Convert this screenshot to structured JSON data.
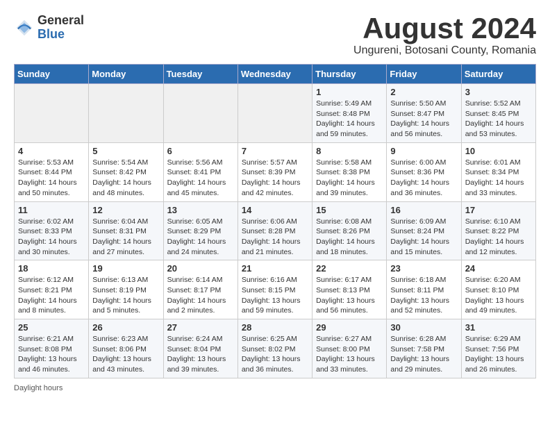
{
  "logo": {
    "general": "General",
    "blue": "Blue"
  },
  "title": {
    "month_year": "August 2024",
    "location": "Ungureni, Botosani County, Romania"
  },
  "headers": [
    "Sunday",
    "Monday",
    "Tuesday",
    "Wednesday",
    "Thursday",
    "Friday",
    "Saturday"
  ],
  "footer": {
    "note": "Daylight hours"
  },
  "weeks": [
    [
      {
        "day": "",
        "info": ""
      },
      {
        "day": "",
        "info": ""
      },
      {
        "day": "",
        "info": ""
      },
      {
        "day": "",
        "info": ""
      },
      {
        "day": "1",
        "info": "Sunrise: 5:49 AM\nSunset: 8:48 PM\nDaylight: 14 hours\nand 59 minutes."
      },
      {
        "day": "2",
        "info": "Sunrise: 5:50 AM\nSunset: 8:47 PM\nDaylight: 14 hours\nand 56 minutes."
      },
      {
        "day": "3",
        "info": "Sunrise: 5:52 AM\nSunset: 8:45 PM\nDaylight: 14 hours\nand 53 minutes."
      }
    ],
    [
      {
        "day": "4",
        "info": "Sunrise: 5:53 AM\nSunset: 8:44 PM\nDaylight: 14 hours\nand 50 minutes."
      },
      {
        "day": "5",
        "info": "Sunrise: 5:54 AM\nSunset: 8:42 PM\nDaylight: 14 hours\nand 48 minutes."
      },
      {
        "day": "6",
        "info": "Sunrise: 5:56 AM\nSunset: 8:41 PM\nDaylight: 14 hours\nand 45 minutes."
      },
      {
        "day": "7",
        "info": "Sunrise: 5:57 AM\nSunset: 8:39 PM\nDaylight: 14 hours\nand 42 minutes."
      },
      {
        "day": "8",
        "info": "Sunrise: 5:58 AM\nSunset: 8:38 PM\nDaylight: 14 hours\nand 39 minutes."
      },
      {
        "day": "9",
        "info": "Sunrise: 6:00 AM\nSunset: 8:36 PM\nDaylight: 14 hours\nand 36 minutes."
      },
      {
        "day": "10",
        "info": "Sunrise: 6:01 AM\nSunset: 8:34 PM\nDaylight: 14 hours\nand 33 minutes."
      }
    ],
    [
      {
        "day": "11",
        "info": "Sunrise: 6:02 AM\nSunset: 8:33 PM\nDaylight: 14 hours\nand 30 minutes."
      },
      {
        "day": "12",
        "info": "Sunrise: 6:04 AM\nSunset: 8:31 PM\nDaylight: 14 hours\nand 27 minutes."
      },
      {
        "day": "13",
        "info": "Sunrise: 6:05 AM\nSunset: 8:29 PM\nDaylight: 14 hours\nand 24 minutes."
      },
      {
        "day": "14",
        "info": "Sunrise: 6:06 AM\nSunset: 8:28 PM\nDaylight: 14 hours\nand 21 minutes."
      },
      {
        "day": "15",
        "info": "Sunrise: 6:08 AM\nSunset: 8:26 PM\nDaylight: 14 hours\nand 18 minutes."
      },
      {
        "day": "16",
        "info": "Sunrise: 6:09 AM\nSunset: 8:24 PM\nDaylight: 14 hours\nand 15 minutes."
      },
      {
        "day": "17",
        "info": "Sunrise: 6:10 AM\nSunset: 8:22 PM\nDaylight: 14 hours\nand 12 minutes."
      }
    ],
    [
      {
        "day": "18",
        "info": "Sunrise: 6:12 AM\nSunset: 8:21 PM\nDaylight: 14 hours\nand 8 minutes."
      },
      {
        "day": "19",
        "info": "Sunrise: 6:13 AM\nSunset: 8:19 PM\nDaylight: 14 hours\nand 5 minutes."
      },
      {
        "day": "20",
        "info": "Sunrise: 6:14 AM\nSunset: 8:17 PM\nDaylight: 14 hours\nand 2 minutes."
      },
      {
        "day": "21",
        "info": "Sunrise: 6:16 AM\nSunset: 8:15 PM\nDaylight: 13 hours\nand 59 minutes."
      },
      {
        "day": "22",
        "info": "Sunrise: 6:17 AM\nSunset: 8:13 PM\nDaylight: 13 hours\nand 56 minutes."
      },
      {
        "day": "23",
        "info": "Sunrise: 6:18 AM\nSunset: 8:11 PM\nDaylight: 13 hours\nand 52 minutes."
      },
      {
        "day": "24",
        "info": "Sunrise: 6:20 AM\nSunset: 8:10 PM\nDaylight: 13 hours\nand 49 minutes."
      }
    ],
    [
      {
        "day": "25",
        "info": "Sunrise: 6:21 AM\nSunset: 8:08 PM\nDaylight: 13 hours\nand 46 minutes."
      },
      {
        "day": "26",
        "info": "Sunrise: 6:23 AM\nSunset: 8:06 PM\nDaylight: 13 hours\nand 43 minutes."
      },
      {
        "day": "27",
        "info": "Sunrise: 6:24 AM\nSunset: 8:04 PM\nDaylight: 13 hours\nand 39 minutes."
      },
      {
        "day": "28",
        "info": "Sunrise: 6:25 AM\nSunset: 8:02 PM\nDaylight: 13 hours\nand 36 minutes."
      },
      {
        "day": "29",
        "info": "Sunrise: 6:27 AM\nSunset: 8:00 PM\nDaylight: 13 hours\nand 33 minutes."
      },
      {
        "day": "30",
        "info": "Sunrise: 6:28 AM\nSunset: 7:58 PM\nDaylight: 13 hours\nand 29 minutes."
      },
      {
        "day": "31",
        "info": "Sunrise: 6:29 AM\nSunset: 7:56 PM\nDaylight: 13 hours\nand 26 minutes."
      }
    ]
  ]
}
